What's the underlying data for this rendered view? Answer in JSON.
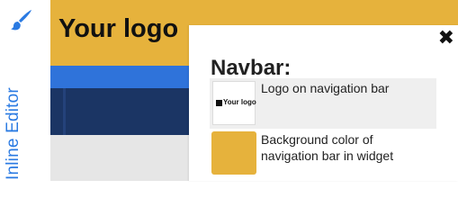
{
  "editor": {
    "label": "Inline Editor",
    "icon": "paintbrush-icon",
    "accent_color": "#2a7ae2"
  },
  "preview": {
    "logo_text": "Your logo",
    "brand_color": "#e6b23c",
    "nav_color": "#2f73da",
    "subnav_color": "#1b3564"
  },
  "panel": {
    "close_glyph": "✖",
    "title": "Navbar:",
    "items": [
      {
        "label": "Logo on navigation bar",
        "thumb_text": "Your logo"
      },
      {
        "label": "Background color of navigation bar in widget",
        "swatch_color": "#e6b23c"
      }
    ]
  }
}
